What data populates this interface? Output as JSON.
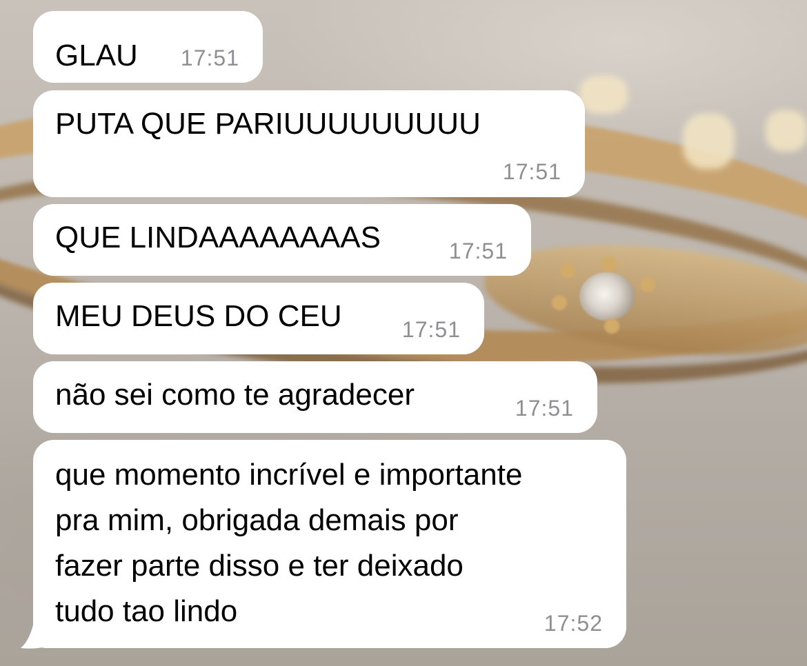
{
  "messages": [
    {
      "text": "GLAU",
      "time": "17:51"
    },
    {
      "text": "PUTA QUE PARIUUUUUUUUU",
      "time": "17:51"
    },
    {
      "text": "QUE LINDAAAAAAAAS",
      "time": "17:51"
    },
    {
      "text": "MEU DEUS DO CEU",
      "time": "17:51"
    },
    {
      "text": "não sei como te agradecer",
      "time": "17:51"
    },
    {
      "lines": [
        "que momento incrível e importante",
        "pra mim, obrigada demais por",
        "fazer parte disso e ter deixado",
        "tudo tao lindo"
      ],
      "time": "17:52"
    }
  ],
  "colors": {
    "bubble": "#ffffff",
    "text": "#000000",
    "timestamp": "#8e8e93"
  }
}
